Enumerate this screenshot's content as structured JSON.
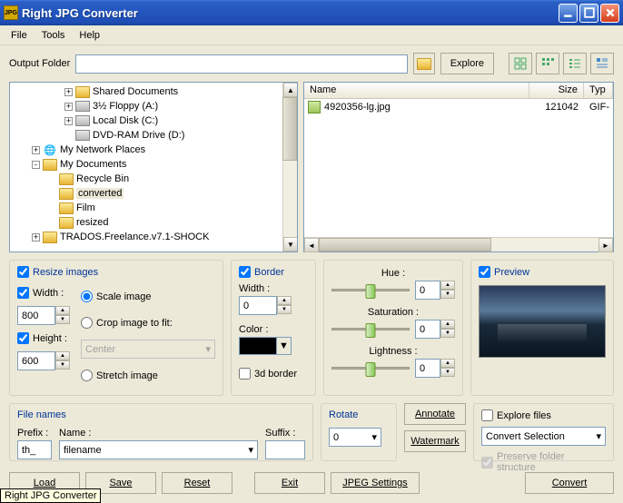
{
  "window": {
    "title": "Right JPG Converter"
  },
  "menu": {
    "file": "File",
    "tools": "Tools",
    "help": "Help"
  },
  "toolbar": {
    "output_folder_label": "Output Folder",
    "explore": "Explore"
  },
  "tree": {
    "items": [
      {
        "indent": 2,
        "expand": "+",
        "icon": "folder",
        "label": "Shared Documents"
      },
      {
        "indent": 2,
        "expand": "+",
        "icon": "drive",
        "label": "3½ Floppy (A:)"
      },
      {
        "indent": 2,
        "expand": "+",
        "icon": "drive",
        "label": "Local Disk (C:)"
      },
      {
        "indent": 2,
        "expand": "",
        "icon": "drive",
        "label": "DVD-RAM Drive (D:)"
      },
      {
        "indent": 0,
        "expand": "+",
        "icon": "network",
        "label": "My Network Places"
      },
      {
        "indent": 0,
        "expand": "-",
        "icon": "folder",
        "label": "My Documents"
      },
      {
        "indent": 1,
        "expand": "",
        "icon": "folder",
        "label": "Recycle Bin"
      },
      {
        "indent": 1,
        "expand": "",
        "icon": "folder",
        "label": "converted",
        "selected": true
      },
      {
        "indent": 1,
        "expand": "",
        "icon": "folder",
        "label": "Film"
      },
      {
        "indent": 1,
        "expand": "",
        "icon": "folder",
        "label": "resized"
      },
      {
        "indent": 0,
        "expand": "+",
        "icon": "folder",
        "label": "TRADOS.Freelance.v7.1-SHOCK"
      }
    ]
  },
  "list": {
    "cols": {
      "name": "Name",
      "size": "Size",
      "type": "Typ"
    },
    "rows": [
      {
        "name": "4920356-lg.jpg",
        "size": "121042",
        "type": "GIF-"
      }
    ]
  },
  "resize": {
    "title": "Resize images",
    "width_label": "Width :",
    "width_value": "800",
    "height_label": "Height :",
    "height_value": "600",
    "scale": "Scale image",
    "crop": "Crop image to fit:",
    "center": "Center",
    "stretch": "Stretch image"
  },
  "border": {
    "title": "Border",
    "width_label": "Width :",
    "width_value": "0",
    "color_label": "Color :",
    "three_d": "3d border"
  },
  "hsl": {
    "hue": "Hue :",
    "hue_value": "0",
    "sat": "Saturation :",
    "sat_value": "0",
    "light": "Lightness :",
    "light_value": "0"
  },
  "preview": {
    "title": "Preview"
  },
  "filenames": {
    "title": "File names",
    "prefix_label": "Prefix :",
    "prefix_value": "th_",
    "name_label": "Name :",
    "name_value": "filename",
    "suffix_label": "Suffix :",
    "suffix_value": ""
  },
  "rotate": {
    "title": "Rotate",
    "value": "0"
  },
  "annotate": "Annotate",
  "watermark": "Watermark",
  "explore": {
    "title": "Explore files",
    "combo": "Convert Selection",
    "preserve": "Preserve folder structure"
  },
  "buttons": {
    "load": "Load",
    "save": "Save",
    "reset": "Reset",
    "exit": "Exit",
    "jpeg": "JPEG Settings",
    "convert": "Convert"
  },
  "status": "Right JPG Converter"
}
